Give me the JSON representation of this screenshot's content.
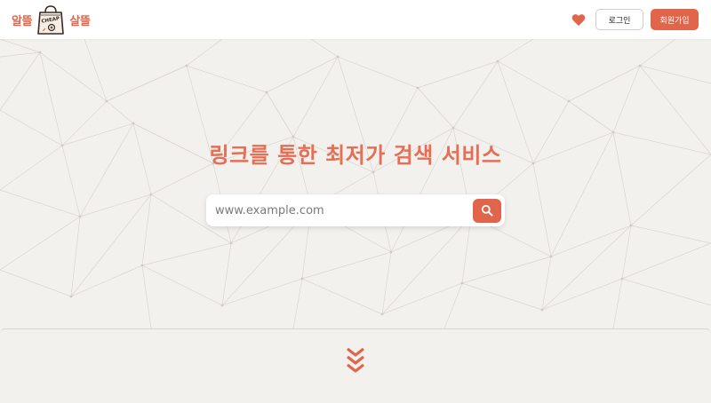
{
  "header": {
    "logo_left": "알뜰",
    "logo_right": "살뜰",
    "logo_bag_text": "CHEAP",
    "login_label": "로그인",
    "signup_label": "회원가입"
  },
  "hero": {
    "headline": "링크를 통한 최저가 검색 서비스",
    "search_placeholder": "www.example.com"
  },
  "colors": {
    "accent": "#e0654a",
    "background": "#f3f1ed",
    "headline": "#e56f55"
  },
  "icons": {
    "logo": "shopping-bag-icon",
    "wishlist": "heart-icon",
    "search": "search-icon",
    "scroll": "chevron-triple-down-icon"
  }
}
